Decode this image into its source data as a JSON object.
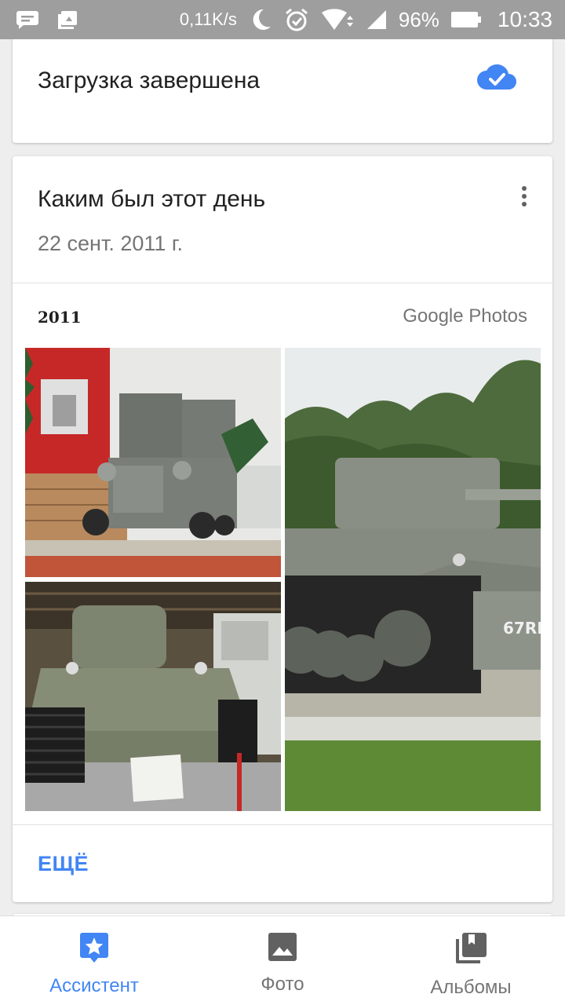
{
  "status_bar": {
    "net_speed": "0,11K/s",
    "battery": "96%",
    "time": "10:33",
    "icons": [
      "message-icon",
      "photo-upload-icon",
      "moon-icon",
      "alarm-icon",
      "wifi-icon",
      "signal-icon",
      "battery-icon"
    ]
  },
  "upload_card": {
    "text": "Загрузка завершена",
    "icon": "cloud-done-icon"
  },
  "memory_card": {
    "title": "Каким был этот день",
    "date": "22 сент. 2011 г.",
    "menu_icon": "more-vert-icon",
    "collage": {
      "year": "2011",
      "brand": "Google Photos"
    },
    "more_label": "ЕЩЁ"
  },
  "bottom_nav": {
    "items": [
      {
        "label": "Ассистент",
        "icon": "assistant-icon",
        "active": true
      },
      {
        "label": "Фото",
        "icon": "photo-icon",
        "active": false
      },
      {
        "label": "Альбомы",
        "icon": "albums-icon",
        "active": false
      }
    ]
  },
  "colors": {
    "accent": "#4285f4",
    "status_bar": "#9e9e9e",
    "background": "#eeeeee"
  }
}
